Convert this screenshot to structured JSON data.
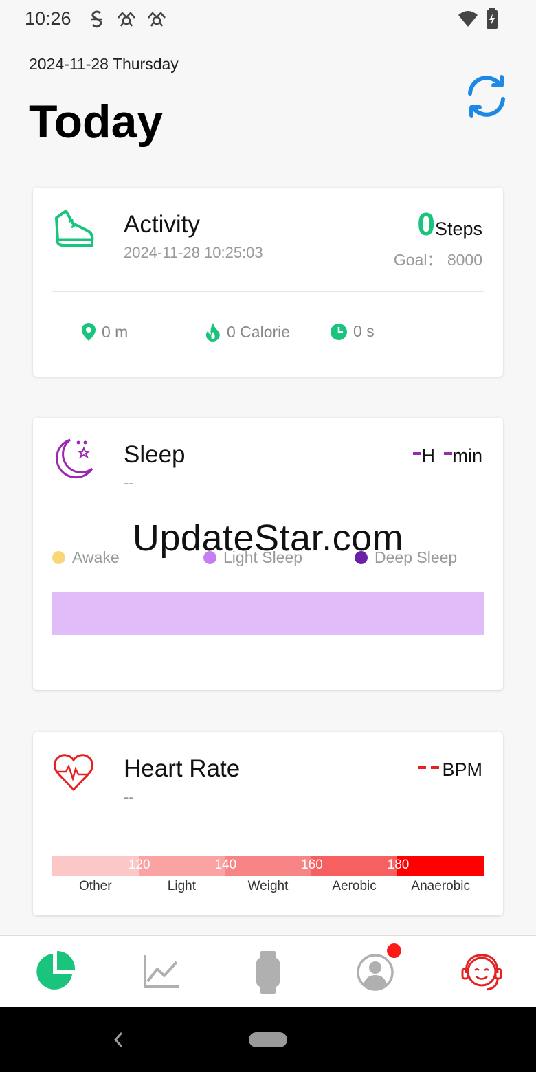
{
  "status_bar": {
    "time": "10:26",
    "icons": [
      "s-notification-icon",
      "cat-notification-icon",
      "cat-notification-icon",
      "wifi-icon",
      "battery-icon"
    ]
  },
  "header": {
    "date": "2024-11-28 Thursday",
    "title": "Today",
    "sync_icon": "sync-icon",
    "accent": "#1e88e5"
  },
  "activity": {
    "title": "Activity",
    "timestamp": "2024-11-28 10:25:03",
    "steps_value": "0",
    "steps_unit": "Steps",
    "goal": "Goal： 8000",
    "distance": "0 m",
    "calories": "0 Calorie",
    "duration": "0 s",
    "color": "#1bc47d"
  },
  "sleep": {
    "title": "Sleep",
    "sub": "--",
    "hours_unit": "H",
    "min_unit": "min",
    "legend": [
      "Awake",
      "Light Sleep",
      "Deep Sleep"
    ],
    "legend_colors": [
      "#f8d778",
      "#c77ef0",
      "#6a1fa8"
    ],
    "color": "#9c27b0"
  },
  "heart_rate": {
    "title": "Heart Rate",
    "sub": "--",
    "unit": "BPM",
    "thresholds": [
      "120",
      "140",
      "160",
      "180"
    ],
    "zones": [
      "Other",
      "Light",
      "Weight",
      "Aerobic",
      "Anaerobic"
    ],
    "zone_colors": [
      "#fbc7c7",
      "#f9a3a3",
      "#f78585",
      "#f76060",
      "#ff0000"
    ],
    "color": "#e52222"
  },
  "watermark": "UpdateStar.com",
  "bottom_nav": {
    "items": [
      "pie-chart-icon",
      "trend-chart-icon",
      "watch-icon",
      "profile-icon",
      "support-agent-icon"
    ],
    "active_color": "#1bc47d"
  }
}
